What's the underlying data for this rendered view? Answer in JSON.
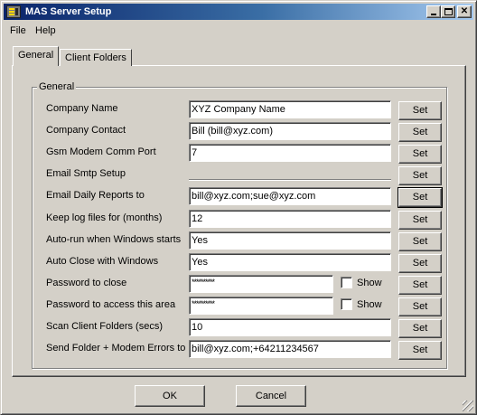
{
  "window": {
    "title": "MAS Server Setup",
    "titlebar_gradient_start": "#0a246a",
    "titlebar_gradient_end": "#a6caf0",
    "face_color": "#d4d0c8"
  },
  "menu": {
    "items": [
      {
        "label": "File"
      },
      {
        "label": "Help"
      }
    ]
  },
  "tabs": [
    {
      "label": "General",
      "selected": true
    },
    {
      "label": "Client Folders",
      "selected": false
    }
  ],
  "group": {
    "title": "General"
  },
  "rows": [
    {
      "label": "Company Name",
      "value": "XYZ Company Name",
      "button": "Set"
    },
    {
      "label": "Company Contact",
      "value": "Bill (bill@xyz.com)",
      "button": "Set"
    },
    {
      "label": "Gsm Modem Comm Port",
      "value": "7",
      "button": "Set"
    },
    {
      "label": "Email Smtp Setup",
      "value": "",
      "button": "Set"
    },
    {
      "label": "Email Daily Reports to",
      "value": "bill@xyz.com;sue@xyz.com",
      "button": "Set"
    },
    {
      "label": "Keep log files for (months)",
      "value": "12",
      "button": "Set"
    },
    {
      "label": "Auto-run when Windows starts",
      "value": "Yes",
      "button": "Set"
    },
    {
      "label": "Auto Close with Windows",
      "value": "Yes",
      "button": "Set"
    },
    {
      "label": "Password to close",
      "value": "**********",
      "button": "Set",
      "checkbox_label": "Show"
    },
    {
      "label": "Password to access this area",
      "value": "**********",
      "button": "Set",
      "checkbox_label": "Show"
    },
    {
      "label": "Scan Client Folders (secs)",
      "value": "10",
      "button": "Set"
    },
    {
      "label": "Send Folder + Modem Errors to",
      "value": "bill@xyz.com;+64211234567",
      "button": "Set"
    }
  ],
  "footer": {
    "ok_label": "OK",
    "cancel_label": "Cancel"
  }
}
